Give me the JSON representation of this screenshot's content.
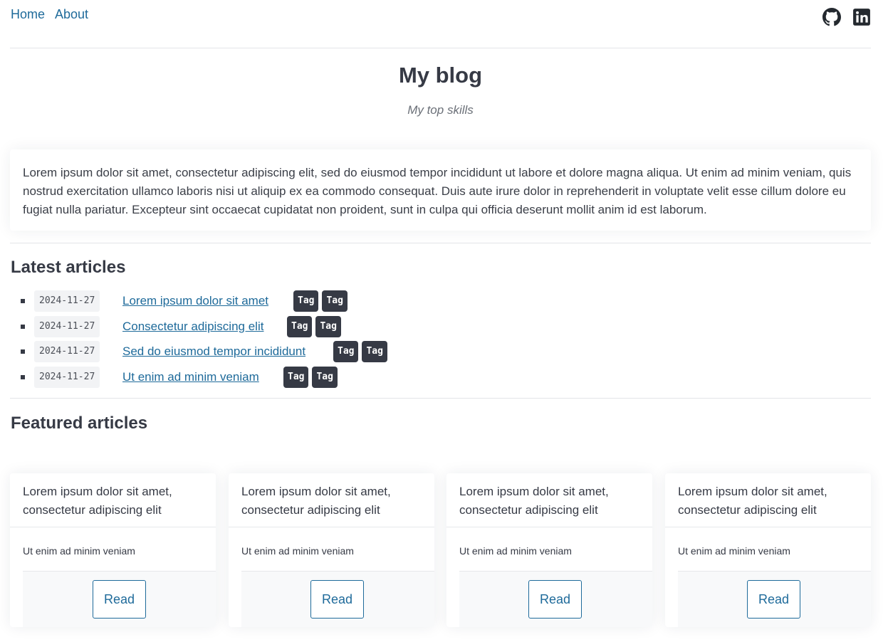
{
  "nav": {
    "links": [
      "Home",
      "About"
    ]
  },
  "social": {
    "icons": [
      "github-icon",
      "linkedin-icon"
    ]
  },
  "header": {
    "title": "My blog",
    "tagline": "My top skills"
  },
  "intro": {
    "text": "Lorem ipsum dolor sit amet, consectetur adipiscing elit, sed do eiusmod tempor incididunt ut labore et dolore magna aliqua. Ut enim ad minim veniam, quis nostrud exercitation ullamco laboris nisi ut aliquip ex ea commodo consequat. Duis aute irure dolor in reprehenderit in voluptate velit esse cillum dolore eu fugiat nulla pariatur. Excepteur sint occaecat cupidatat non proident, sunt in culpa qui officia deserunt mollit anim id est laborum."
  },
  "latest": {
    "title": "Latest articles",
    "items": [
      {
        "date": "2024-11-27",
        "title": "Lorem ipsum dolor sit amet",
        "tags": [
          "Tag",
          "Tag"
        ]
      },
      {
        "date": "2024-11-27",
        "title": "Consectetur adipiscing elit",
        "tags": [
          "Tag",
          "Tag"
        ]
      },
      {
        "date": "2024-11-27",
        "title": "Sed do eiusmod tempor incididunt",
        "tags": [
          "Tag",
          "Tag"
        ]
      },
      {
        "date": "2024-11-27",
        "title": "Ut enim ad minim veniam",
        "tags": [
          "Tag",
          "Tag"
        ]
      }
    ]
  },
  "featured": {
    "title": "Featured articles",
    "cards": [
      {
        "title": "Lorem ipsum dolor sit amet, consectetur adipiscing elit",
        "summary": "Ut enim ad minim veniam",
        "button": "Read"
      },
      {
        "title": "Lorem ipsum dolor sit amet, consectetur adipiscing elit",
        "summary": "Ut enim ad minim veniam",
        "button": "Read"
      },
      {
        "title": "Lorem ipsum dolor sit amet, consectetur adipiscing elit",
        "summary": "Ut enim ad minim veniam",
        "button": "Read"
      },
      {
        "title": "Lorem ipsum dolor sit amet, consectetur adipiscing elit",
        "summary": "Ut enim ad minim veniam",
        "button": "Read"
      }
    ]
  },
  "colors": {
    "text": "#363a45",
    "link": "#1e6a9a",
    "tag_bg": "#363a45",
    "divider": "#e3e5e8"
  }
}
